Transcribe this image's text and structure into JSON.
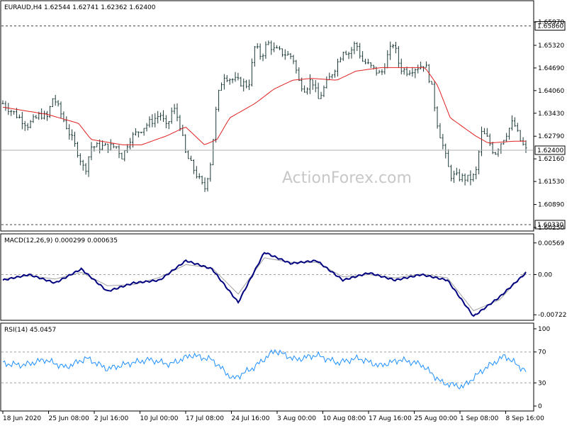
{
  "chart_data": [
    {
      "type": "ohlc",
      "title": "EURAUD,H4  1.62544 1.62741 1.62362 1.62400",
      "symbol": "EURAUD",
      "timeframe": "H4",
      "quote": {
        "open": 1.62544,
        "high": 1.62741,
        "low": 1.62362,
        "close": 1.624
      },
      "last_price": 1.624,
      "last_price_label": "1.62400",
      "ylim": [
        1.6025,
        1.6599
      ],
      "yticks": [
        "1.65970",
        "1.65320",
        "1.64690",
        "1.64060",
        "1.63430",
        "1.62790",
        "1.62160",
        "1.61530",
        "1.60890",
        "1.60250"
      ],
      "levels": [
        {
          "value": 1.6586,
          "label": "1.65860",
          "style": "dashed"
        },
        {
          "value": 1.6033,
          "label": "1.60330",
          "style": "dashed"
        }
      ],
      "moving_average_color": "#e02020",
      "bar_color": "#1e3a3a",
      "close_sample": [
        {
          "x": "18 Jun 2020",
          "y": 1.637
        },
        {
          "x": "22 Jun 2020",
          "y": 1.631
        },
        {
          "x": "24 Jun 2020",
          "y": 1.634
        },
        {
          "x": "25 Jun 2020",
          "y": 1.633
        },
        {
          "x": "26 Jun 2020",
          "y": 1.639
        },
        {
          "x": "29 Jun 2020",
          "y": 1.627
        },
        {
          "x": "30 Jun 2020",
          "y": 1.623
        },
        {
          "x": "1 Jul 2020",
          "y": 1.618
        },
        {
          "x": "2 Jul 2020",
          "y": 1.625
        },
        {
          "x": "6 Jul 2020",
          "y": 1.625
        },
        {
          "x": "7 Jul 2020",
          "y": 1.622
        },
        {
          "x": "8 Jul 2020",
          "y": 1.627
        },
        {
          "x": "10 Jul 2020",
          "y": 1.63
        },
        {
          "x": "13 Jul 2020",
          "y": 1.634
        },
        {
          "x": "14 Jul 2020",
          "y": 1.63
        },
        {
          "x": "15 Jul 2020",
          "y": 1.636
        },
        {
          "x": "16 Jul 2020",
          "y": 1.632
        },
        {
          "x": "17 Jul 2020",
          "y": 1.623
        },
        {
          "x": "20 Jul 2020",
          "y": 1.613
        },
        {
          "x": "21 Jul 2020",
          "y": 1.621
        },
        {
          "x": "22 Jul 2020",
          "y": 1.638
        },
        {
          "x": "23 Jul 2020",
          "y": 1.645
        },
        {
          "x": "24 Jul 2020",
          "y": 1.644
        },
        {
          "x": "27 Jul 2020",
          "y": 1.642
        },
        {
          "x": "28 Jul 2020",
          "y": 1.653
        },
        {
          "x": "29 Jul 2020",
          "y": 1.65
        },
        {
          "x": "30 Jul 2020",
          "y": 1.654
        },
        {
          "x": "31 Jul 2020",
          "y": 1.652
        },
        {
          "x": "3 Aug 2020",
          "y": 1.65
        },
        {
          "x": "4 Aug 2020",
          "y": 1.643
        },
        {
          "x": "5 Aug 2020",
          "y": 1.641
        },
        {
          "x": "6 Aug 2020",
          "y": 1.644
        },
        {
          "x": "7 Aug 2020",
          "y": 1.638
        },
        {
          "x": "10 Aug 2020",
          "y": 1.648
        },
        {
          "x": "11 Aug 2020",
          "y": 1.652
        },
        {
          "x": "12 Aug 2020",
          "y": 1.651
        },
        {
          "x": "13 Aug 2020",
          "y": 1.654
        },
        {
          "x": "14 Aug 2020",
          "y": 1.649
        },
        {
          "x": "17 Aug 2020",
          "y": 1.645
        },
        {
          "x": "18 Aug 2020",
          "y": 1.65
        },
        {
          "x": "19 Aug 2020",
          "y": 1.654
        },
        {
          "x": "20 Aug 2020",
          "y": 1.647
        },
        {
          "x": "21 Aug 2020",
          "y": 1.646
        },
        {
          "x": "24 Aug 2020",
          "y": 1.648
        },
        {
          "x": "25 Aug 2020",
          "y": 1.642
        },
        {
          "x": "26 Aug 2020",
          "y": 1.631
        },
        {
          "x": "27 Aug 2020",
          "y": 1.624
        },
        {
          "x": "28 Aug 2020",
          "y": 1.617
        },
        {
          "x": "31 Aug 2020",
          "y": 1.616
        },
        {
          "x": "1 Sep 2020",
          "y": 1.617
        },
        {
          "x": "2 Sep 2020",
          "y": 1.629
        },
        {
          "x": "3 Sep 2020",
          "y": 1.627
        },
        {
          "x": "4 Sep 2020",
          "y": 1.623
        },
        {
          "x": "7 Sep 2020",
          "y": 1.632
        },
        {
          "x": "8 Sep 2020",
          "y": 1.627
        },
        {
          "x": "9 Sep 2020",
          "y": 1.624
        }
      ],
      "ma_sample": [
        {
          "x": "18 Jun 2020",
          "y": 1.636
        },
        {
          "x": "25 Jun 2020",
          "y": 1.634
        },
        {
          "x": "30 Jun 2020",
          "y": 1.6315
        },
        {
          "x": "2 Jul 2020",
          "y": 1.627
        },
        {
          "x": "7 Jul 2020",
          "y": 1.6255
        },
        {
          "x": "10 Jul 2020",
          "y": 1.6255
        },
        {
          "x": "14 Jul 2020",
          "y": 1.628
        },
        {
          "x": "17 Jul 2020",
          "y": 1.6305
        },
        {
          "x": "20 Jul 2020",
          "y": 1.6255
        },
        {
          "x": "22 Jul 2020",
          "y": 1.627
        },
        {
          "x": "24 Jul 2020",
          "y": 1.633
        },
        {
          "x": "28 Jul 2020",
          "y": 1.637
        },
        {
          "x": "31 Jul 2020",
          "y": 1.641
        },
        {
          "x": "3 Aug 2020",
          "y": 1.6435
        },
        {
          "x": "6 Aug 2020",
          "y": 1.644
        },
        {
          "x": "10 Aug 2020",
          "y": 1.6435
        },
        {
          "x": "13 Aug 2020",
          "y": 1.646
        },
        {
          "x": "17 Aug 2020",
          "y": 1.647
        },
        {
          "x": "20 Aug 2020",
          "y": 1.647
        },
        {
          "x": "24 Aug 2020",
          "y": 1.647
        },
        {
          "x": "26 Aug 2020",
          "y": 1.642
        },
        {
          "x": "28 Aug 2020",
          "y": 1.633
        },
        {
          "x": "1 Sep 2020",
          "y": 1.628
        },
        {
          "x": "3 Sep 2020",
          "y": 1.626
        },
        {
          "x": "7 Sep 2020",
          "y": 1.6265
        },
        {
          "x": "9 Sep 2020",
          "y": 1.6265
        }
      ],
      "xticks": [
        "18 Jun 2020",
        "25 Jun 08:00",
        "2 Jul 16:00",
        "10 Jul 00:00",
        "17 Jul 08:00",
        "24 Jul 16:00",
        "3 Aug 00:00",
        "10 Aug 08:00",
        "17 Aug 16:00",
        "25 Aug 00:00",
        "1 Sep 08:00",
        "8 Sep 16:00"
      ]
    },
    {
      "type": "line",
      "title": "MACD(12,26,9) 0.000299 0.000635",
      "ylim": [
        -0.0077,
        0.0063
      ],
      "yticks": [
        "0.00569",
        "0.00",
        "-0.00722"
      ],
      "series": [
        {
          "name": "MACD",
          "color": "#000080",
          "x": [
            0,
            5,
            10,
            15,
            20,
            25,
            30,
            35,
            40,
            45,
            50,
            55,
            60,
            65,
            70,
            75,
            80,
            85,
            90,
            95,
            100
          ],
          "values": [
            -0.001,
            0.0,
            -0.0015,
            0.001,
            -0.003,
            -0.0015,
            -0.001,
            0.0025,
            0.001,
            -0.005,
            0.004,
            0.002,
            0.0025,
            -0.001,
            0.0003,
            -0.001,
            0.0,
            -0.001,
            -0.0075,
            -0.004,
            0.0003
          ]
        },
        {
          "name": "Signal",
          "color": "#a0a0a0",
          "x": [
            0,
            5,
            10,
            15,
            20,
            25,
            30,
            35,
            40,
            45,
            50,
            55,
            60,
            65,
            70,
            75,
            80,
            85,
            90,
            95,
            100
          ],
          "values": [
            -0.0008,
            -0.0002,
            -0.0008,
            0.0004,
            -0.002,
            -0.0018,
            -0.0005,
            0.0018,
            0.0012,
            -0.0035,
            0.003,
            0.0022,
            0.0022,
            -0.0004,
            0.0,
            -0.0006,
            0.0001,
            -0.0006,
            -0.0065,
            -0.0045,
            0.0006
          ]
        }
      ],
      "zero_line": true
    },
    {
      "type": "line",
      "title": "RSI(14) 45.0457",
      "ylim": [
        0,
        100
      ],
      "yticks": [
        "100",
        "70",
        "30",
        "0"
      ],
      "levels": [
        70,
        30
      ],
      "series": [
        {
          "name": "RSI",
          "color": "#1e90ff",
          "x": [
            0,
            4,
            8,
            12,
            16,
            20,
            24,
            28,
            32,
            36,
            40,
            44,
            48,
            52,
            56,
            60,
            64,
            68,
            72,
            76,
            80,
            84,
            88,
            92,
            96,
            100
          ],
          "values": [
            55,
            53,
            60,
            50,
            62,
            48,
            55,
            60,
            54,
            66,
            60,
            35,
            50,
            72,
            60,
            66,
            56,
            62,
            52,
            60,
            54,
            30,
            25,
            48,
            65,
            45
          ]
        }
      ]
    }
  ],
  "watermark": "ActionForex.com"
}
